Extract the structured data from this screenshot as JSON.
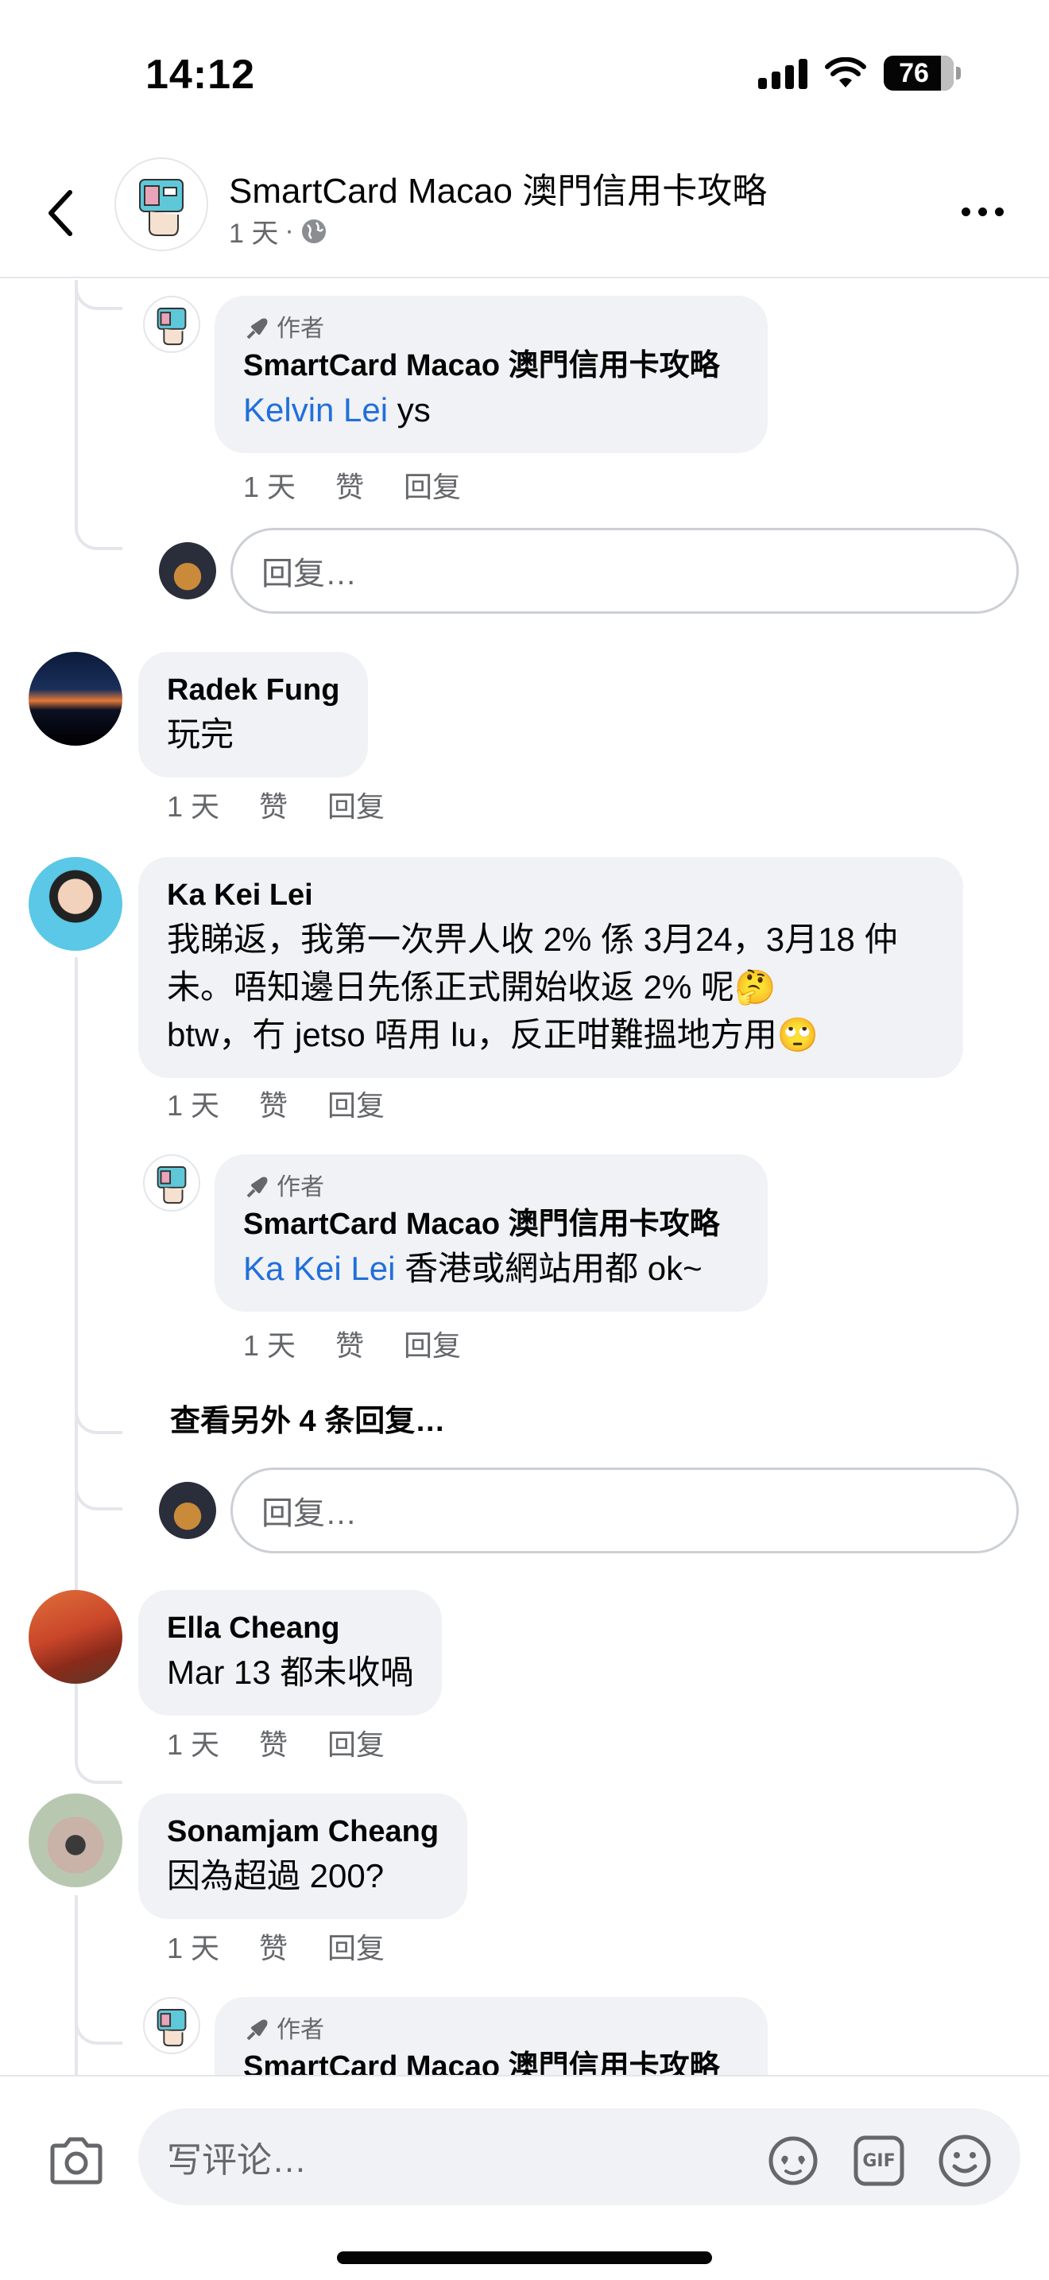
{
  "status_bar": {
    "time": "14:12",
    "battery": "76"
  },
  "header": {
    "page_name": "SmartCard Macao 澳門信用卡攻略",
    "age": "1 天",
    "separator": "·"
  },
  "labels": {
    "author": "作者",
    "reply_placeholder": "回复…",
    "like": "赞",
    "reply": "回复"
  },
  "comments": {
    "c0_reply": {
      "author_badge": "作者",
      "name": "SmartCard Macao 澳門信用卡攻略",
      "mention": "Kelvin Lei",
      "text": " ys",
      "time": "1 天"
    },
    "c1": {
      "name": "Radek Fung",
      "text": "玩完",
      "time": "1 天"
    },
    "c2": {
      "name": "Ka Kei Lei",
      "lines": [
        "我睇返，我第一次畀人收 2% 係 3月24，3月18 仲",
        "未。唔知邊日先係正式開始收返 2% 呢🤔",
        "btw，冇 jetso 唔用 lu，反正咁難搵地方用🙄"
      ],
      "time": "1 天"
    },
    "c2_reply": {
      "author_badge": "作者",
      "name": "SmartCard Macao 澳門信用卡攻略",
      "mention": "Ka Kei Lei",
      "text": " 香港或網站用都 ok~",
      "time": "1 天"
    },
    "c2_view_more": "查看另外 4 条回复…",
    "c3": {
      "name": "Ella Cheang",
      "text": "Mar 13 都未收喎",
      "time": "1 天"
    },
    "c4": {
      "name": "Sonamjam Cheang",
      "text": "因為超過 200?",
      "time": "1 天"
    },
    "c4_reply": {
      "author_badge": "作者",
      "name": "SmartCard Macao 澳門信用卡攻略"
    }
  },
  "composer": {
    "placeholder": "写评论…",
    "gif": "GIF"
  },
  "colors": {
    "mention": "#216fdb",
    "bubble": "#f0f2f5",
    "secondary_text": "#65676b",
    "divider": "#e4e6eb"
  }
}
